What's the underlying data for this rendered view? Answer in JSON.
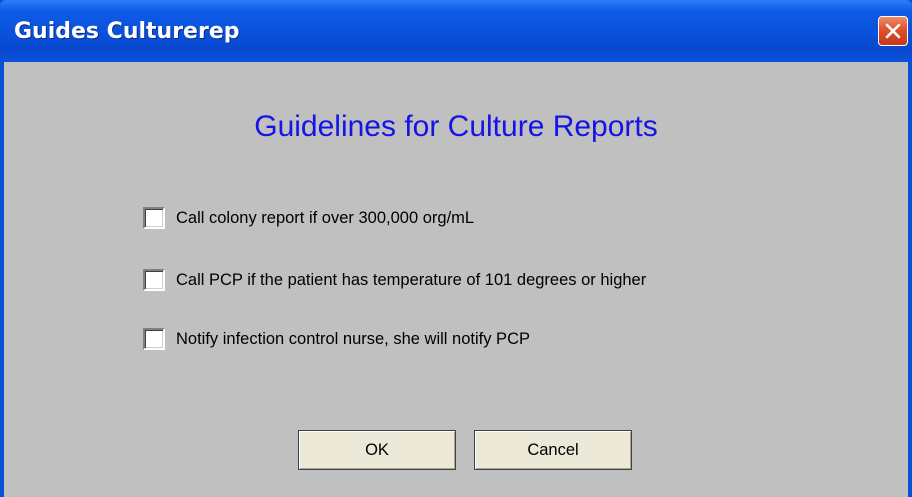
{
  "window": {
    "title": "Guides Culturerep"
  },
  "dialog": {
    "heading": "Guidelines for Culture Reports",
    "options": [
      {
        "label": "Call colony report if over 300,000 org/mL",
        "checked": false
      },
      {
        "label": "Call PCP if the patient has temperature of 101 degrees or higher",
        "checked": false
      },
      {
        "label": "Notify infection control nurse, she will notify PCP",
        "checked": false
      }
    ],
    "ok_label": "OK",
    "cancel_label": "Cancel"
  },
  "icons": {
    "close": "close-icon"
  },
  "colors": {
    "titlebar": "#0a52dc",
    "background": "#c0c0c0",
    "heading": "#1414e6",
    "close_button": "#e0502a",
    "button_face": "#ece9d8"
  }
}
